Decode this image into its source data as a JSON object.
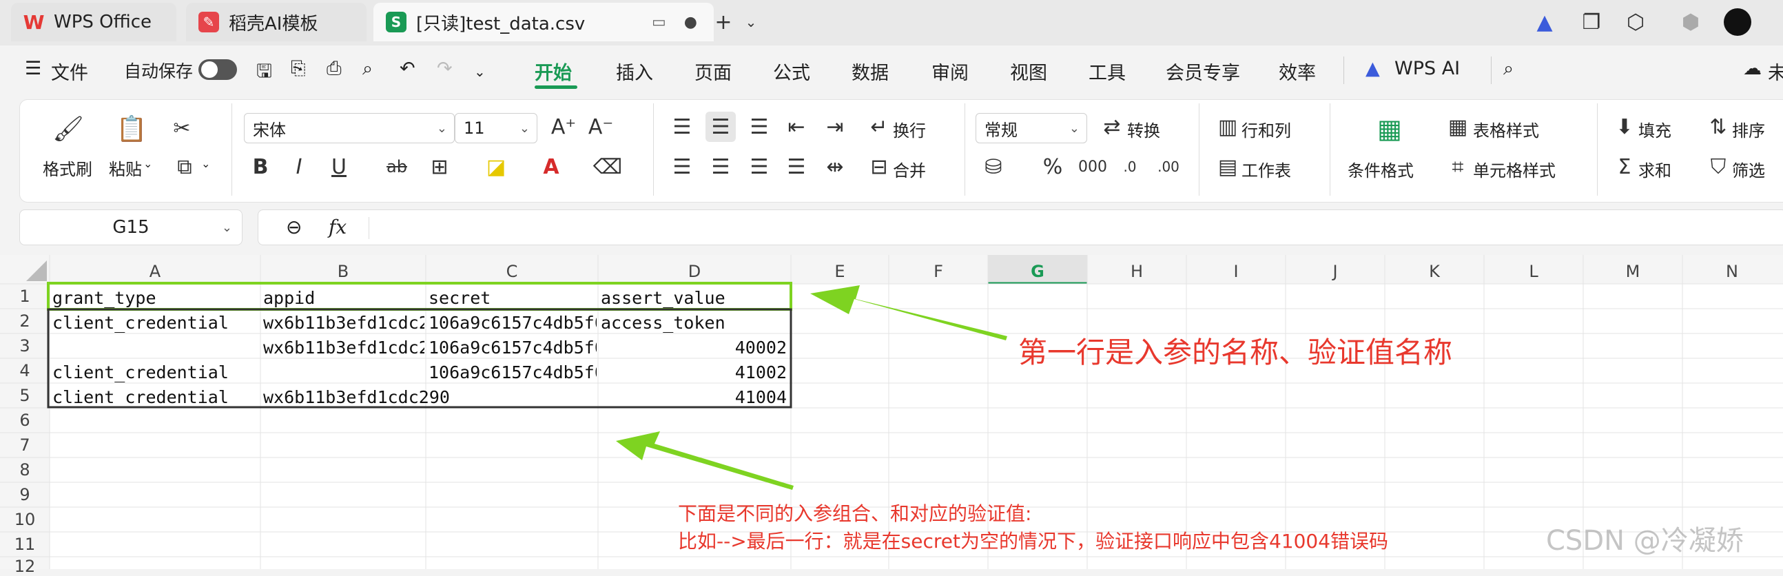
{
  "tabs": [
    {
      "label": "WPS Office",
      "icon": "wps-logo-icon"
    },
    {
      "label": "稻壳AI模板",
      "icon": "docer-icon"
    },
    {
      "label": "[只读]test_data.csv",
      "icon": "spreadsheet-icon"
    }
  ],
  "menu": {
    "file": "文件",
    "autosave": "自动保存",
    "items": [
      "开始",
      "插入",
      "页面",
      "公式",
      "数据",
      "审阅",
      "视图",
      "工具",
      "会员专享",
      "效率"
    ],
    "wps_ai": "WPS AI",
    "right_label": "未"
  },
  "ribbon": {
    "format_painter": "格式刷",
    "paste": "粘贴",
    "font_name": "宋体",
    "font_size": "11",
    "wrap": "换行",
    "merge": "合并",
    "number_format": "常规",
    "convert": "转换",
    "row_col": "行和列",
    "worksheet": "工作表",
    "cond_format": "条件格式",
    "table_style": "表格样式",
    "cell_style": "单元格样式",
    "fill": "填充",
    "sort": "排序",
    "sum": "求和",
    "filter": "筛选"
  },
  "formula_bar": {
    "name_box": "G15",
    "fx": "fx"
  },
  "grid": {
    "columns": [
      "A",
      "B",
      "C",
      "D",
      "E",
      "F",
      "G",
      "H",
      "I",
      "J",
      "K",
      "L",
      "M",
      "N"
    ],
    "rows": [
      "1",
      "2",
      "3",
      "4",
      "5",
      "6",
      "7",
      "8",
      "9",
      "10",
      "11",
      "12"
    ],
    "cells": [
      [
        "grant_type",
        "appid",
        "secret",
        "assert_value"
      ],
      [
        "client_credential",
        "wx6b11b3efd1cdc2",
        "106a9c6157c4db5f0",
        "access_token"
      ],
      [
        "",
        "wx6b11b3efd1cdc2",
        "106a9c6157c4db5f0",
        "40002"
      ],
      [
        "client_credential",
        "",
        "106a9c6157c4db5f0",
        "41002"
      ],
      [
        "client_credential",
        "wx6b11b3efd1cdc290",
        "",
        "41004"
      ]
    ]
  },
  "annotations": {
    "header_note": "第一行是入参的名称、验证值名称",
    "body_note_line1": "下面是不同的入参组合、和对应的验证值:",
    "body_note_line2": "比如-->最后一行：就是在secret为空的情况下，验证接口响应中包含41004错误码",
    "watermark": "CSDN @冷凝娇"
  },
  "colors": {
    "accent": "#1a9a55",
    "annotation": "#e8382d",
    "highlight_box": "#7ed321"
  }
}
